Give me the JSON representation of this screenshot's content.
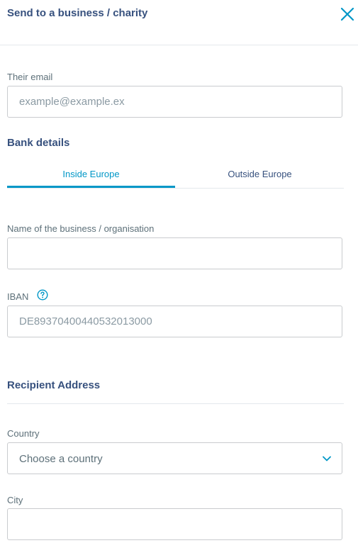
{
  "header": {
    "title": "Send to a business / charity",
    "close_icon": "close-icon"
  },
  "email": {
    "label": "Their email",
    "placeholder": "example@example.ex",
    "value": ""
  },
  "bank_details": {
    "title": "Bank details",
    "tabs": [
      {
        "label": "Inside Europe",
        "active": true
      },
      {
        "label": "Outside Europe",
        "active": false
      }
    ]
  },
  "business_name": {
    "label": "Name of the business / organisation",
    "value": ""
  },
  "iban": {
    "label": "IBAN",
    "help_icon": "help-circle-icon",
    "placeholder": "DE89370400440532013000",
    "value": ""
  },
  "recipient_address": {
    "title": "Recipient Address"
  },
  "country": {
    "label": "Country",
    "selected": "Choose a country",
    "icon": "chevron-down-icon"
  },
  "city": {
    "label": "City",
    "value": ""
  },
  "colors": {
    "accent": "#0097c7",
    "heading": "#37517e",
    "label": "#5d7079",
    "border": "#c9cbce"
  }
}
